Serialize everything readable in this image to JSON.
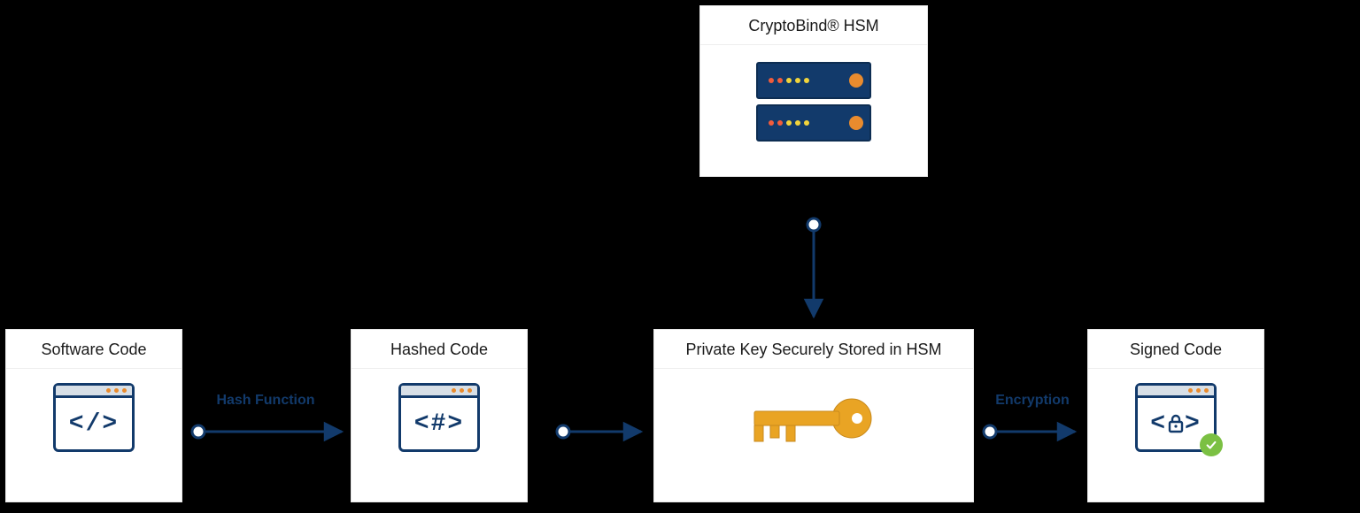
{
  "nodes": {
    "hsm": {
      "title": "CryptoBind® HSM"
    },
    "software": {
      "title": "Software Code",
      "glyph": "</>"
    },
    "hashed": {
      "title": "Hashed Code",
      "glyph": "<#>"
    },
    "private_key": {
      "title": "Private Key Securely Stored in HSM"
    },
    "signed": {
      "title": "Signed Code"
    }
  },
  "arrows": {
    "hash_function": "Hash Function",
    "encryption": "Encryption"
  },
  "colors": {
    "line": "#123a6b",
    "accent": "#e98b2e",
    "key": "#e9a424",
    "check": "#7bc043"
  }
}
